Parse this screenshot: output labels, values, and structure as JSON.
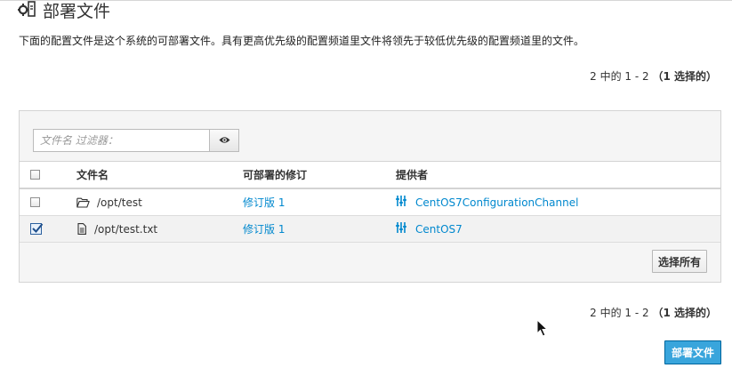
{
  "page": {
    "title": "部署文件",
    "description": "下面的配置文件是这个系统的可部署文件。具有更高优先级的配置频道里文件将领先于较低优先级的配置频道里的文件。",
    "pager_prefix": "2 中的 1 - 2",
    "pager_selected": "（1 选择的）"
  },
  "filter": {
    "placeholder": "文件名 过滤器：",
    "value": ""
  },
  "table": {
    "headers": {
      "name": "文件名",
      "revision": "可部署的修订",
      "provider": "提供者"
    },
    "rows": [
      {
        "checked": false,
        "type": "folder",
        "name": "/opt/test",
        "revision": "修订版 1",
        "provider": "CentOS7ConfigurationChannel"
      },
      {
        "checked": true,
        "type": "file",
        "name": "/opt/test.txt",
        "revision": "修订版 1",
        "provider": "CentOS7"
      }
    ]
  },
  "buttons": {
    "select_all": "选择所有",
    "deploy": "部署文件"
  },
  "icons": {
    "title": "config-files-icon",
    "filter": "eye-icon",
    "folder": "folder-open-icon",
    "file": "file-icon",
    "channel": "sliders-icon"
  },
  "colors": {
    "link": "#0088ce",
    "primary_button": "#39a5dc"
  }
}
